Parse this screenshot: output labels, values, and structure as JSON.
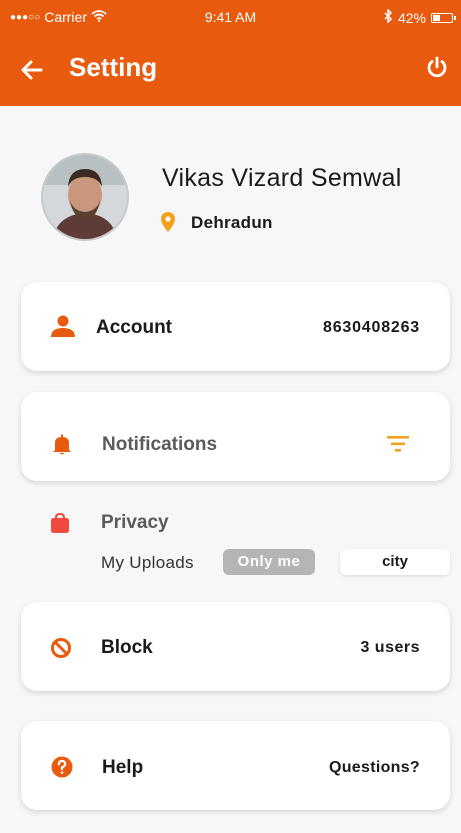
{
  "status_bar": {
    "carrier": "Carrier",
    "time": "9:41 AM",
    "battery": "42%",
    "battery_level": 0.42,
    "signal_dots": "●●●○○"
  },
  "header": {
    "title": "Setting",
    "back_icon": "arrow-left-icon",
    "power_icon": "power-icon"
  },
  "profile": {
    "name": "Vikas Vizard Semwal",
    "location": "Dehradun"
  },
  "account": {
    "label": "Account",
    "value": "8630408263"
  },
  "notifications": {
    "label": "Notifications",
    "icon": "filter-icon"
  },
  "privacy": {
    "title": "Privacy",
    "uploads_label": "My Uploads",
    "option_only_me": "Only me",
    "option_city": "city"
  },
  "block": {
    "label": "Block",
    "value": "3 users"
  },
  "help": {
    "label": "Help",
    "value": "Questions?"
  },
  "colors": {
    "brand": "#e85a0d",
    "accent_amber": "#f3a21b",
    "background": "#f7f7f7"
  }
}
